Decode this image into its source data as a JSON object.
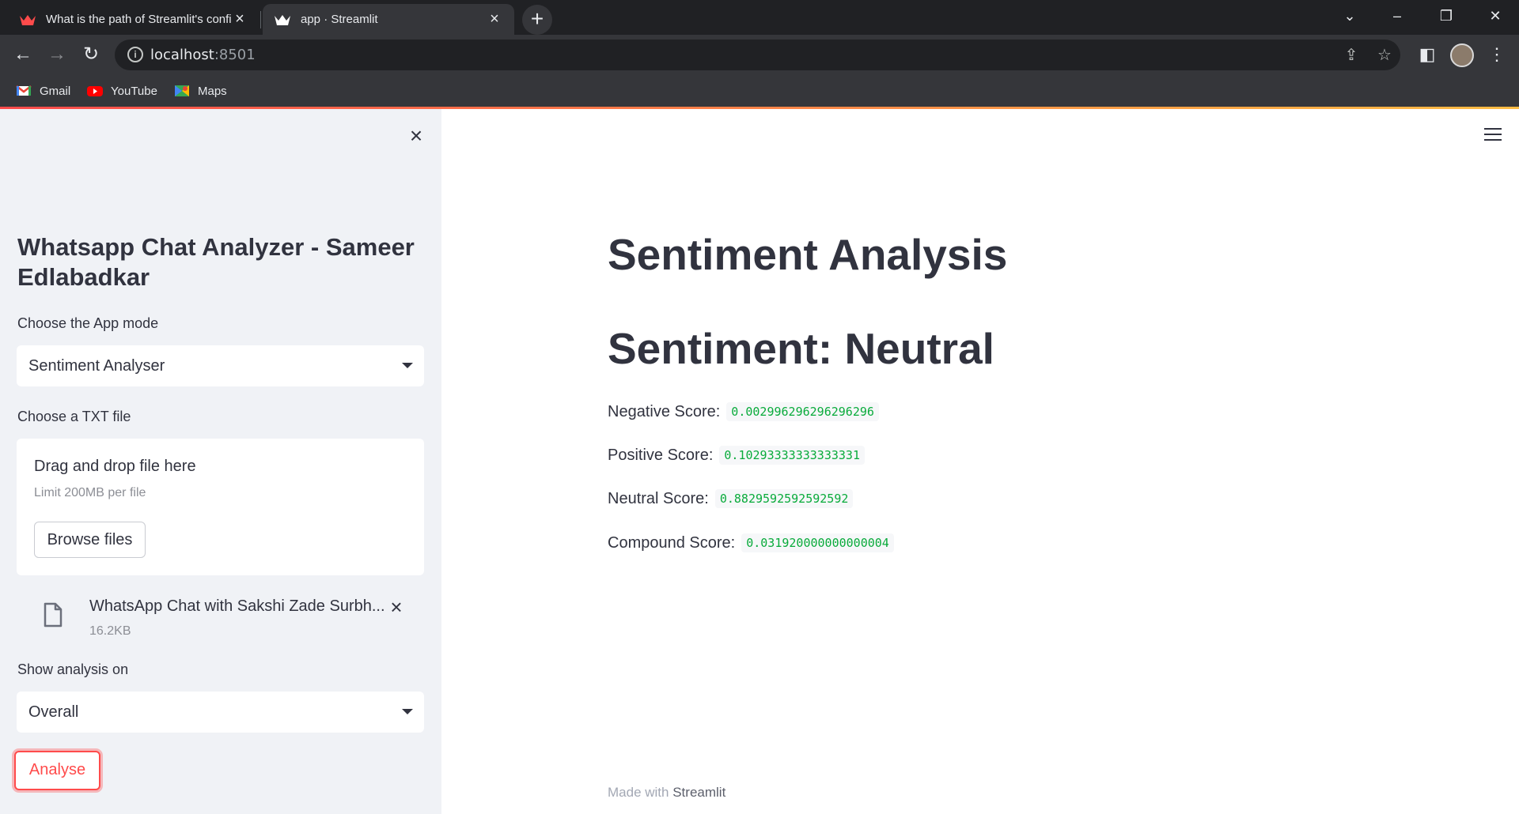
{
  "browser": {
    "tabs": [
      {
        "title": "What is the path of Streamlit's confi",
        "active": false
      },
      {
        "title": "app · Streamlit",
        "active": true
      }
    ],
    "url_host": "localhost",
    "url_port": ":8501",
    "bookmarks": [
      {
        "label": "Gmail",
        "icon": "gmail-icon"
      },
      {
        "label": "YouTube",
        "icon": "youtube-icon"
      },
      {
        "label": "Maps",
        "icon": "maps-icon"
      }
    ]
  },
  "sidebar": {
    "title": "Whatsapp Chat Analyzer - Sameer Edlabadkar",
    "mode_label": "Choose the App mode",
    "mode_value": "Sentiment Analyser",
    "file_label": "Choose a TXT file",
    "uploader": {
      "drag_text": "Drag and drop file here",
      "limit_text": "Limit 200MB per file",
      "browse_label": "Browse files"
    },
    "file": {
      "name": "WhatsApp Chat with Sakshi Zade Surbh...",
      "size": "16.2KB"
    },
    "analysis_label": "Show analysis on",
    "analysis_value": "Overall",
    "analyse_button": "Analyse"
  },
  "main": {
    "heading": "Sentiment Analysis",
    "sentiment": "Sentiment: Neutral",
    "scores": [
      {
        "label": "Negative Score:",
        "value": "0.002996296296296296"
      },
      {
        "label": "Positive Score:",
        "value": "0.10293333333333331"
      },
      {
        "label": "Neutral Score:",
        "value": "0.8829592592592592"
      },
      {
        "label": "Compound Score:",
        "value": "0.031920000000000004"
      }
    ],
    "footer_prefix": "Made with",
    "footer_brand": "Streamlit"
  },
  "colors": {
    "accent": "#ff4b4b",
    "code_green": "#09ab3b",
    "sidebar_bg": "#f0f2f6",
    "text": "#31333f"
  }
}
